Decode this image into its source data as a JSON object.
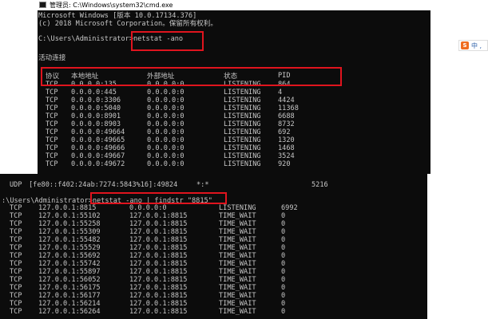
{
  "window1": {
    "title": "管理员: C:\\Windows\\system32\\cmd.exe",
    "banner_line1": "Microsoft Windows [版本 10.0.17134.376]",
    "banner_line2": "(c) 2018 Microsoft Corporation。保留所有权利。",
    "prompt": "C:\\Users\\Administrator>",
    "command": "netstat -ano",
    "section": "活动连接",
    "headers": [
      "协议",
      "本地地址",
      "外部地址",
      "状态",
      "PID"
    ],
    "rows": [
      [
        "TCP",
        "0.0.0.0:135",
        "0.0.0.0:0",
        "LISTENING",
        "864"
      ],
      [
        "TCP",
        "0.0.0.0:445",
        "0.0.0.0:0",
        "LISTENING",
        "4"
      ],
      [
        "TCP",
        "0.0.0.0:3306",
        "0.0.0.0:0",
        "LISTENING",
        "4424"
      ],
      [
        "TCP",
        "0.0.0.0:5040",
        "0.0.0.0:0",
        "LISTENING",
        "11368"
      ],
      [
        "TCP",
        "0.0.0.0:8901",
        "0.0.0.0:0",
        "LISTENING",
        "6688"
      ],
      [
        "TCP",
        "0.0.0.0:8903",
        "0.0.0.0:0",
        "LISTENING",
        "8732"
      ],
      [
        "TCP",
        "0.0.0.0:49664",
        "0.0.0.0:0",
        "LISTENING",
        "692"
      ],
      [
        "TCP",
        "0.0.0.0:49665",
        "0.0.0.0:0",
        "LISTENING",
        "1320"
      ],
      [
        "TCP",
        "0.0.0.0:49666",
        "0.0.0.0:0",
        "LISTENING",
        "1468"
      ],
      [
        "TCP",
        "0.0.0.0:49667",
        "0.0.0.0:0",
        "LISTENING",
        "3524"
      ],
      [
        "TCP",
        "0.0.0.0:49672",
        "0.0.0.0:0",
        "LISTENING",
        "920"
      ]
    ]
  },
  "window2": {
    "top_row": [
      "UDP",
      "[fe80::f402:24ab:7274:5843%16]:49824",
      "*:*",
      "",
      "5216"
    ],
    "prompt": ":\\Users\\Administrator>",
    "command": "netstat -ano | findstr \"8815\"",
    "rows": [
      [
        "TCP",
        "127.0.0.1:8815",
        "0.0.0.0:0",
        "LISTENING",
        "6992"
      ],
      [
        "TCP",
        "127.0.0.1:55102",
        "127.0.0.1:8815",
        "TIME_WAIT",
        "0"
      ],
      [
        "TCP",
        "127.0.0.1:55258",
        "127.0.0.1:8815",
        "TIME_WAIT",
        "0"
      ],
      [
        "TCP",
        "127.0.0.1:55309",
        "127.0.0.1:8815",
        "TIME_WAIT",
        "0"
      ],
      [
        "TCP",
        "127.0.0.1:55482",
        "127.0.0.1:8815",
        "TIME_WAIT",
        "0"
      ],
      [
        "TCP",
        "127.0.0.1:55529",
        "127.0.0.1:8815",
        "TIME_WAIT",
        "0"
      ],
      [
        "TCP",
        "127.0.0.1:55692",
        "127.0.0.1:8815",
        "TIME_WAIT",
        "0"
      ],
      [
        "TCP",
        "127.0.0.1:55742",
        "127.0.0.1:8815",
        "TIME_WAIT",
        "0"
      ],
      [
        "TCP",
        "127.0.0.1:55897",
        "127.0.0.1:8815",
        "TIME_WAIT",
        "0"
      ],
      [
        "TCP",
        "127.0.0.1:56052",
        "127.0.0.1:8815",
        "TIME_WAIT",
        "0"
      ],
      [
        "TCP",
        "127.0.0.1:56175",
        "127.0.0.1:8815",
        "TIME_WAIT",
        "0"
      ],
      [
        "TCP",
        "127.0.0.1:56177",
        "127.0.0.1:8815",
        "TIME_WAIT",
        "0"
      ],
      [
        "TCP",
        "127.0.0.1:56214",
        "127.0.0.1:8815",
        "TIME_WAIT",
        "0"
      ],
      [
        "TCP",
        "127.0.0.1:56264",
        "127.0.0.1:8815",
        "TIME_WAIT",
        "0"
      ]
    ]
  },
  "ime": {
    "logo": "S",
    "text": "中 ,"
  },
  "colors": {
    "terminal_bg": "#0c0c0c",
    "terminal_text": "#c7c7c7",
    "highlight": "#e0141e"
  }
}
